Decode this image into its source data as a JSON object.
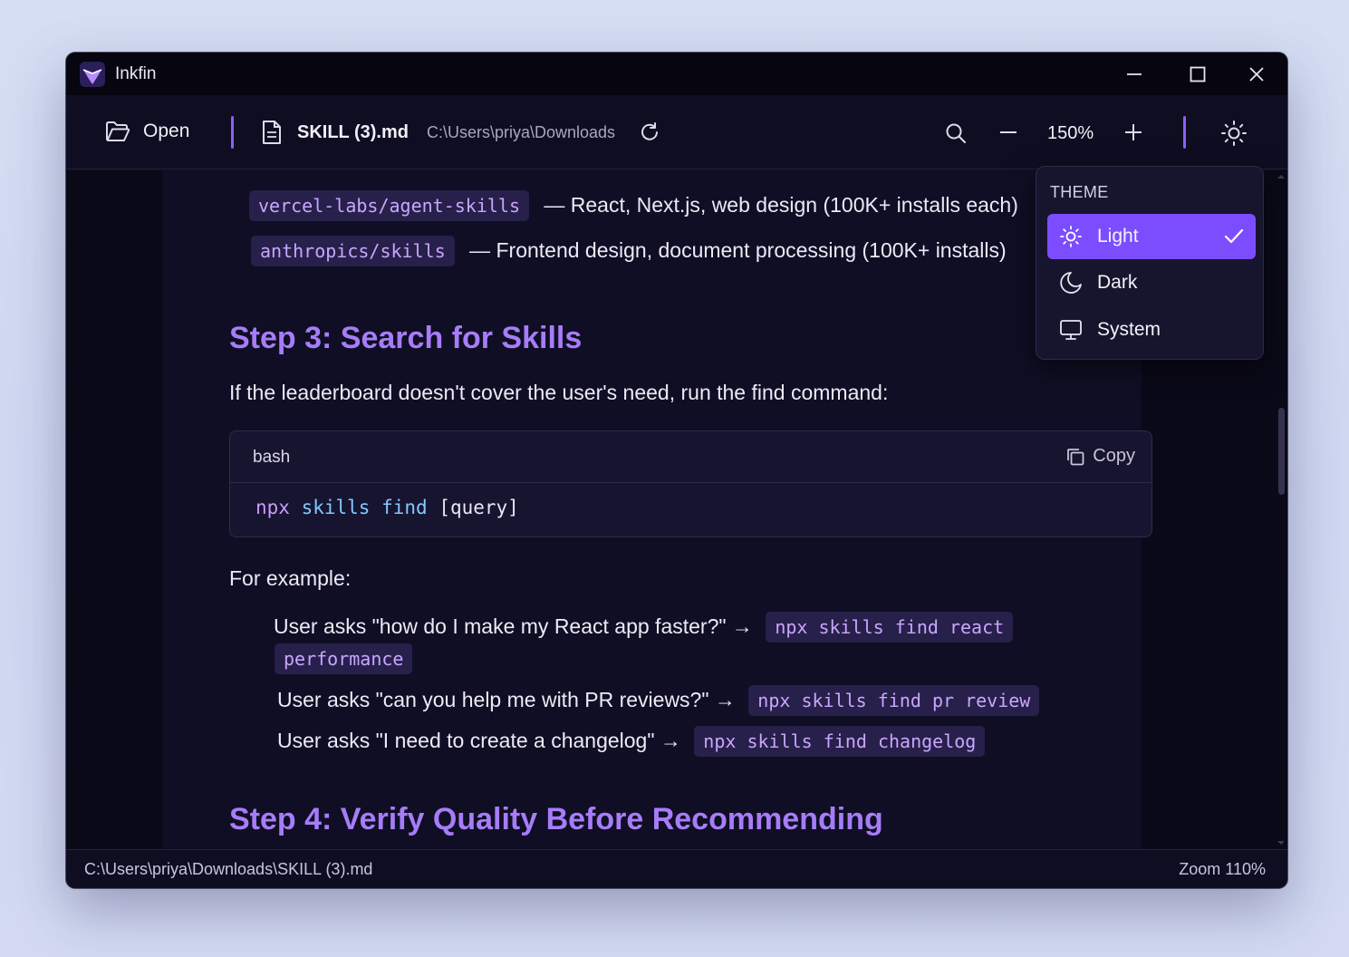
{
  "window": {
    "title": "Inkfin"
  },
  "toolbar": {
    "open_label": "Open",
    "file_name": "SKILL (3).md",
    "file_dir": "C:\\Users\\priya\\Downloads",
    "zoom": "150%"
  },
  "doc": {
    "lines": [
      {
        "code": "vercel-labs/agent-skills",
        "text": "— React, Next.js, web design (100K+ installs each)"
      },
      {
        "code": "anthropics/skills",
        "text": "— Frontend design, document processing (100K+ installs)"
      }
    ],
    "step3_heading": "Step 3: Search for Skills",
    "step3_intro": "If the leaderboard doesn't cover the user's need, run the find command:",
    "codeblock": {
      "lang": "bash",
      "copy_label": "Copy",
      "tok_cmd": "npx",
      "tok_args": "skills find",
      "tok_rest": "[query]"
    },
    "example_intro": "For example:",
    "examples": [
      {
        "text": "User asks \"how do I make my React app faster?\" →",
        "code": "npx skills find react",
        "code_cont": "performance"
      },
      {
        "text": "User asks \"can you help me with PR reviews?\" →",
        "code": "npx skills find pr review"
      },
      {
        "text": "User asks \"I need to create a changelog\" →",
        "code": "npx skills find changelog"
      }
    ],
    "step4_heading": "Step 4: Verify Quality Before Recommending"
  },
  "theme_menu": {
    "header": "THEME",
    "items": [
      {
        "label": "Light",
        "icon": "sun-icon",
        "selected": true
      },
      {
        "label": "Dark",
        "icon": "moon-icon",
        "selected": false
      },
      {
        "label": "System",
        "icon": "monitor-icon",
        "selected": false
      }
    ]
  },
  "statusbar": {
    "path": "C:\\Users\\priya\\Downloads\\SKILL (3).md",
    "zoom": "Zoom 110%"
  },
  "colors": {
    "accent": "#7c4dff",
    "heading": "#a77cf8",
    "inline_code_bg": "#27204a",
    "inline_code_fg": "#c9a6ff",
    "background": "#0c0b1d"
  }
}
